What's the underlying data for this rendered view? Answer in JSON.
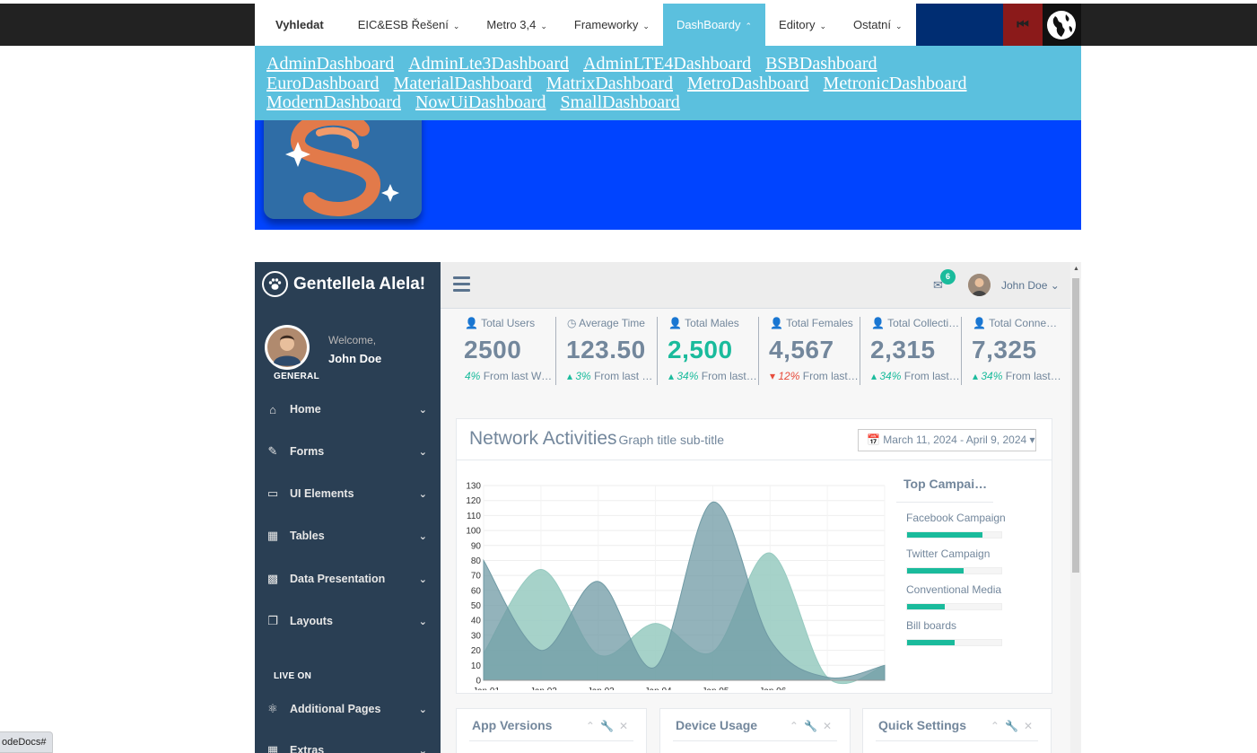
{
  "topnav": {
    "items": [
      {
        "label": "Vyhledat"
      },
      {
        "label": "EIC&ESB Řešení"
      },
      {
        "label": "Metro 3,4"
      },
      {
        "label": "Frameworky"
      },
      {
        "label": "DashBoardy"
      },
      {
        "label": "Editory"
      },
      {
        "label": "Ostatní"
      }
    ],
    "active": "DashBoardy",
    "prev_icon": "fast-backward-icon",
    "globe_icon": "globe-icon"
  },
  "dropdown": {
    "links": [
      "AdminDashboard",
      "AdminLte3Dashboard",
      "AdminLTE4Dashboard",
      "BSBDashboard",
      "EuroDashboard",
      "MaterialDashboard",
      "MatrixDashboard",
      "MetroDashboard",
      "MetronicDashboard",
      "ModernDashboard",
      "NowUiDashboard",
      "SmallDashboard"
    ]
  },
  "dashboard": {
    "brand": "Gentellela Alela!",
    "welcome": "Welcome,",
    "user": "John Doe",
    "section_general": "GENERAL",
    "section_live": "LIVE ON",
    "menu": [
      {
        "label": "Home",
        "icon": "home-icon"
      },
      {
        "label": "Forms",
        "icon": "edit-icon"
      },
      {
        "label": "UI Elements",
        "icon": "desktop-icon"
      },
      {
        "label": "Tables",
        "icon": "table-icon"
      },
      {
        "label": "Data Presentation",
        "icon": "bar-chart-icon"
      },
      {
        "label": "Layouts",
        "icon": "clone-icon"
      },
      {
        "label": "Additional Pages",
        "icon": "bug-icon"
      },
      {
        "label": "Extras",
        "icon": "windows-icon"
      }
    ],
    "topbar": {
      "mail_count": "6",
      "user": "John Doe"
    },
    "tiles": [
      {
        "label": "Total Users",
        "value": "2500",
        "pct": "4%",
        "change": "From last Week",
        "trend": "none",
        "green": false
      },
      {
        "label": "Average Time",
        "value": "123.50",
        "pct": "3%",
        "change": "From last Week",
        "trend": "up",
        "green": false
      },
      {
        "label": "Total Males",
        "value": "2,500",
        "pct": "34%",
        "change": "From last Week",
        "trend": "up",
        "green": true
      },
      {
        "label": "Total Females",
        "value": "4,567",
        "pct": "12%",
        "change": "From last Week",
        "trend": "down",
        "green": false
      },
      {
        "label": "Total Collections",
        "value": "2,315",
        "pct": "34%",
        "change": "From last Week",
        "trend": "up",
        "green": false
      },
      {
        "label": "Total Connections",
        "value": "7,325",
        "pct": "34%",
        "change": "From last Week",
        "trend": "up",
        "green": false
      }
    ],
    "chart": {
      "title": "Network Activities",
      "subtitle": "Graph title sub-title",
      "date_range": "March 11, 2024 - April 9, 2024"
    },
    "campaigns": {
      "title": "Top Campaign Performance",
      "items": [
        {
          "name": "Facebook Campaign",
          "pct": 80
        },
        {
          "name": "Twitter Campaign",
          "pct": 60
        },
        {
          "name": "Conventional Media",
          "pct": 40
        },
        {
          "name": "Bill boards",
          "pct": 50
        }
      ]
    },
    "widgets": [
      {
        "title": "App Versions"
      },
      {
        "title": "Device Usage"
      },
      {
        "title": "Quick Settings"
      }
    ]
  },
  "chart_data": {
    "type": "area",
    "x": [
      "Jan 01",
      "Jan 02",
      "Jan 03",
      "Jan 04",
      "Jan 05",
      "Jan 06"
    ],
    "ylim": [
      0,
      130
    ],
    "yticks": [
      0,
      10,
      20,
      30,
      40,
      50,
      60,
      70,
      80,
      90,
      100,
      110,
      120,
      130
    ],
    "series": [
      {
        "color": "#96cac0",
        "values": [
          18,
          74,
          17,
          38,
          19,
          85,
          2,
          10
        ]
      },
      {
        "color": "#6f9aa4",
        "values": [
          80,
          20,
          66,
          9,
          119,
          27,
          2,
          10
        ]
      }
    ],
    "x_extended": [
      "Jan 01",
      "Jan 02",
      "Jan 03",
      "Jan 04",
      "Jan 05",
      "Jan 06",
      "",
      ""
    ],
    "grid": true
  },
  "statusbar": {
    "text": "odeDocs#"
  }
}
